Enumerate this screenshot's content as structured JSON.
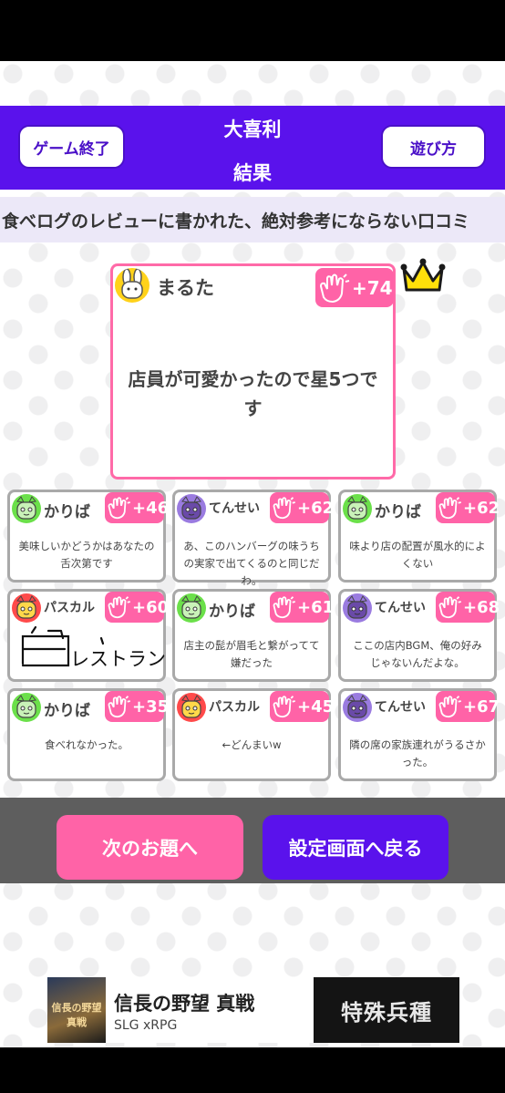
{
  "header": {
    "end_game_label": "ゲーム終了",
    "title_line1": "大喜利",
    "title_line2": "結果",
    "how_to_play_label": "遊び方"
  },
  "topic": "食べログのレビューに書かれた、絶対参考にならない口コミ",
  "winner": {
    "name": "まるた",
    "score": "+74",
    "answer": "店員が可愛かったので星5つです",
    "avatar": "rabbit-yellow"
  },
  "results": [
    {
      "name": "かりば",
      "score": "+46",
      "answer": "美味しいかどうかはあなたの舌次第です",
      "avatar": "green"
    },
    {
      "name": "てんせい",
      "score": "+62",
      "answer": "あ、このハンバーグの味うちの実家で出てくるのと同じだわ。",
      "avatar": "purple"
    },
    {
      "name": "かりば",
      "score": "+62",
      "answer": "味より店の配置が風水的によくない",
      "avatar": "green"
    },
    {
      "name": "パスカル",
      "score": "+60",
      "answer": "",
      "avatar": "red",
      "drawing": "レストラン"
    },
    {
      "name": "かりば",
      "score": "+61",
      "answer": "店主の髭が眉毛と繋がってて嫌だった",
      "avatar": "green"
    },
    {
      "name": "てんせい",
      "score": "+68",
      "answer": "ここの店内BGM、俺の好みじゃないんだよな。",
      "avatar": "purple"
    },
    {
      "name": "かりば",
      "score": "+35",
      "answer": "食べれなかった。",
      "avatar": "green"
    },
    {
      "name": "パスカル",
      "score": "+45",
      "answer": "←どんまいw",
      "avatar": "red"
    },
    {
      "name": "てんせい",
      "score": "+67",
      "answer": "隣の席の家族連れがうるさかった。",
      "avatar": "purple"
    }
  ],
  "actions": {
    "next_label": "次のお題へ",
    "back_label": "設定画面へ戻る"
  },
  "ad": {
    "title": "信長の野望 真戦",
    "subtitle": "SLG xRPG",
    "thumb_text": "信長の野望 真戦",
    "banner_text": "特殊兵種"
  },
  "colors": {
    "purple": "#5a12ec",
    "pink": "#ff63a7"
  }
}
